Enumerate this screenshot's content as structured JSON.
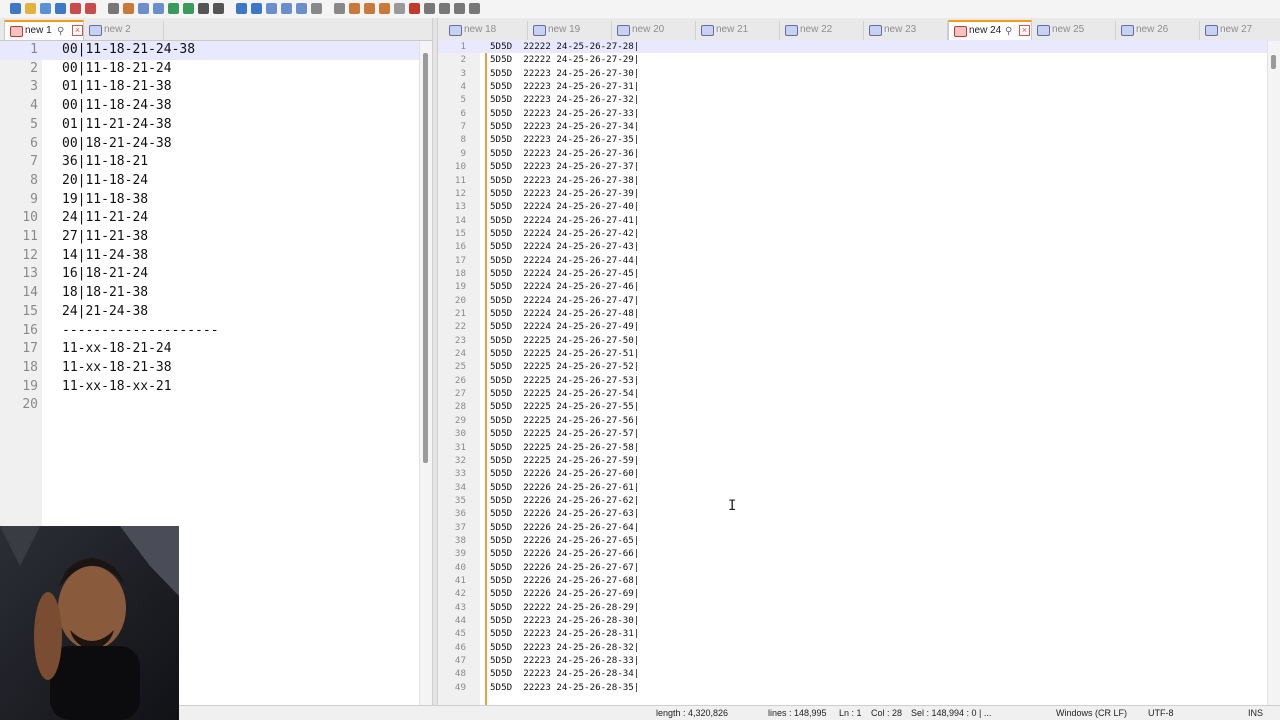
{
  "toolbar": {
    "icons": [
      "new-file",
      "open-file",
      "save",
      "save-all",
      "close",
      "close-all",
      "print",
      "cut",
      "copy",
      "paste",
      "undo",
      "redo",
      "find",
      "replace",
      "zoom-in",
      "zoom-out",
      "sync-vertical",
      "sync-horizontal",
      "word-wrap",
      "show-all-chars",
      "indent-guide",
      "doc-map",
      "function-list",
      "folder-workspace",
      "monitor",
      "record-macro",
      "stop-record",
      "playback",
      "run-macro",
      "save-macro"
    ]
  },
  "left_editor": {
    "tabs": [
      {
        "label": "new 1",
        "active": true
      },
      {
        "label": "new 2",
        "active": false
      }
    ],
    "current_line": 1,
    "lines": [
      "00|11-18-21-24-38",
      "00|11-18-21-24",
      "01|11-18-21-38",
      "00|11-18-24-38",
      "01|11-21-24-38",
      "00|18-21-24-38",
      "36|11-18-21",
      "20|11-18-24",
      "19|11-18-38",
      "24|11-21-24",
      "27|11-21-38",
      "14|11-24-38",
      "16|18-21-24",
      "18|18-21-38",
      "24|21-24-38",
      "--------------------",
      "11-xx-18-21-24",
      "11-xx-18-21-38",
      "11-xx-18-xx-21",
      ""
    ]
  },
  "right_editor": {
    "tabs": [
      {
        "label": "new 18",
        "active": false
      },
      {
        "label": "new 19",
        "active": false
      },
      {
        "label": "new 20",
        "active": false
      },
      {
        "label": "new 21",
        "active": false
      },
      {
        "label": "new 22",
        "active": false
      },
      {
        "label": "new 23",
        "active": false
      },
      {
        "label": "new 24",
        "active": true
      },
      {
        "label": "new 25",
        "active": false
      },
      {
        "label": "new 26",
        "active": false
      },
      {
        "label": "new 27",
        "active": false
      }
    ],
    "current_line": 1,
    "lines": [
      "5D5D  22222 24-25-26-27-28|",
      "5D5D  22222 24-25-26-27-29|",
      "5D5D  22223 24-25-26-27-30|",
      "5D5D  22223 24-25-26-27-31|",
      "5D5D  22223 24-25-26-27-32|",
      "5D5D  22223 24-25-26-27-33|",
      "5D5D  22223 24-25-26-27-34|",
      "5D5D  22223 24-25-26-27-35|",
      "5D5D  22223 24-25-26-27-36|",
      "5D5D  22223 24-25-26-27-37|",
      "5D5D  22223 24-25-26-27-38|",
      "5D5D  22223 24-25-26-27-39|",
      "5D5D  22224 24-25-26-27-40|",
      "5D5D  22224 24-25-26-27-41|",
      "5D5D  22224 24-25-26-27-42|",
      "5D5D  22224 24-25-26-27-43|",
      "5D5D  22224 24-25-26-27-44|",
      "5D5D  22224 24-25-26-27-45|",
      "5D5D  22224 24-25-26-27-46|",
      "5D5D  22224 24-25-26-27-47|",
      "5D5D  22224 24-25-26-27-48|",
      "5D5D  22224 24-25-26-27-49|",
      "5D5D  22225 24-25-26-27-50|",
      "5D5D  22225 24-25-26-27-51|",
      "5D5D  22225 24-25-26-27-52|",
      "5D5D  22225 24-25-26-27-53|",
      "5D5D  22225 24-25-26-27-54|",
      "5D5D  22225 24-25-26-27-55|",
      "5D5D  22225 24-25-26-27-56|",
      "5D5D  22225 24-25-26-27-57|",
      "5D5D  22225 24-25-26-27-58|",
      "5D5D  22225 24-25-26-27-59|",
      "5D5D  22226 24-25-26-27-60|",
      "5D5D  22226 24-25-26-27-61|",
      "5D5D  22226 24-25-26-27-62|",
      "5D5D  22226 24-25-26-27-63|",
      "5D5D  22226 24-25-26-27-64|",
      "5D5D  22226 24-25-26-27-65|",
      "5D5D  22226 24-25-26-27-66|",
      "5D5D  22226 24-25-26-27-67|",
      "5D5D  22226 24-25-26-27-68|",
      "5D5D  22226 24-25-26-27-69|",
      "5D5D  22222 24-25-26-28-29|",
      "5D5D  22223 24-25-26-28-30|",
      "5D5D  22223 24-25-26-28-31|",
      "5D5D  22223 24-25-26-28-32|",
      "5D5D  22223 24-25-26-28-33|",
      "5D5D  22223 24-25-26-28-34|",
      "5D5D  22223 24-25-26-28-35|"
    ]
  },
  "status": {
    "length": "length : 4,320,826",
    "lines": "lines : 148,995",
    "ln": "Ln : 1",
    "col": "Col : 28",
    "sel": "Sel : 148,994 : 0 | ...",
    "eol": "Windows (CR LF)",
    "encoding": "UTF-8",
    "mode": "INS"
  },
  "colors": {
    "accent_tab": "#f39c12",
    "fold_marker": "#e6a23c",
    "current_line": "#e8e8ff"
  }
}
